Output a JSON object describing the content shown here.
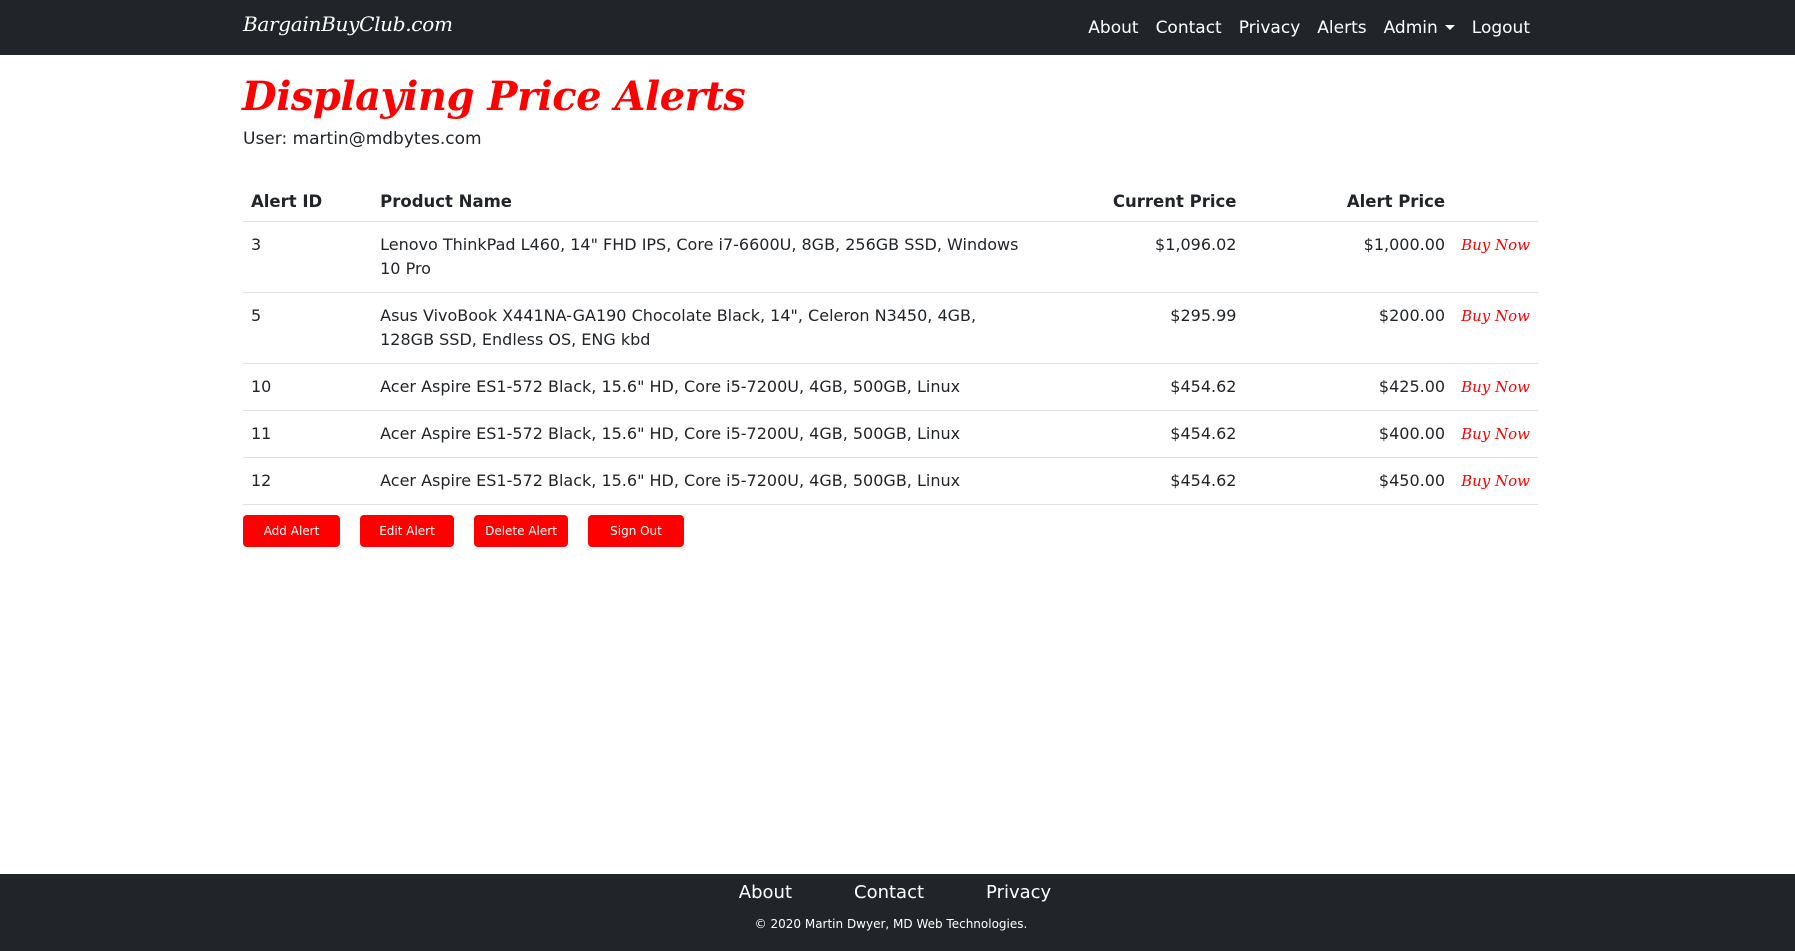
{
  "brand": "BargainBuyClub.com",
  "nav": {
    "about": "About",
    "contact": "Contact",
    "privacy": "Privacy",
    "alerts": "Alerts",
    "admin": "Admin",
    "logout": "Logout"
  },
  "page": {
    "title": "Displaying Price Alerts",
    "user_line": "User: martin@mdbytes.com"
  },
  "table": {
    "headers": {
      "alert_id": "Alert ID",
      "product_name": "Product Name",
      "current_price": "Current Price",
      "alert_price": "Alert Price"
    },
    "rows": [
      {
        "id": "3",
        "name": "Lenovo ThinkPad L460, 14\" FHD IPS, Core i7-6600U, 8GB, 256GB SSD, Windows 10 Pro",
        "current": "$1,096.02",
        "alert": "$1,000.00",
        "buy": "Buy Now"
      },
      {
        "id": "5",
        "name": "Asus VivoBook X441NA-GA190 Chocolate Black, 14\", Celeron N3450, 4GB, 128GB SSD, Endless OS, ENG kbd",
        "current": "$295.99",
        "alert": "$200.00",
        "buy": "Buy Now"
      },
      {
        "id": "10",
        "name": "Acer Aspire ES1-572 Black, 15.6\" HD, Core i5-7200U, 4GB, 500GB, Linux",
        "current": "$454.62",
        "alert": "$425.00",
        "buy": "Buy Now"
      },
      {
        "id": "11",
        "name": "Acer Aspire ES1-572 Black, 15.6\" HD, Core i5-7200U, 4GB, 500GB, Linux",
        "current": "$454.62",
        "alert": "$400.00",
        "buy": "Buy Now"
      },
      {
        "id": "12",
        "name": "Acer Aspire ES1-572 Black, 15.6\" HD, Core i5-7200U, 4GB, 500GB, Linux",
        "current": "$454.62",
        "alert": "$450.00",
        "buy": "Buy Now"
      }
    ]
  },
  "buttons": {
    "add": "Add Alert",
    "edit": "Edit Alert",
    "delete": "Delete Alert",
    "signout": "Sign Out"
  },
  "footer": {
    "about": "About",
    "contact": "Contact",
    "privacy": "Privacy",
    "copyright": "© 2020 Martin Dwyer, MD Web Technologies."
  },
  "colors": {
    "accent": "#ff0000",
    "navbar": "#212529"
  }
}
